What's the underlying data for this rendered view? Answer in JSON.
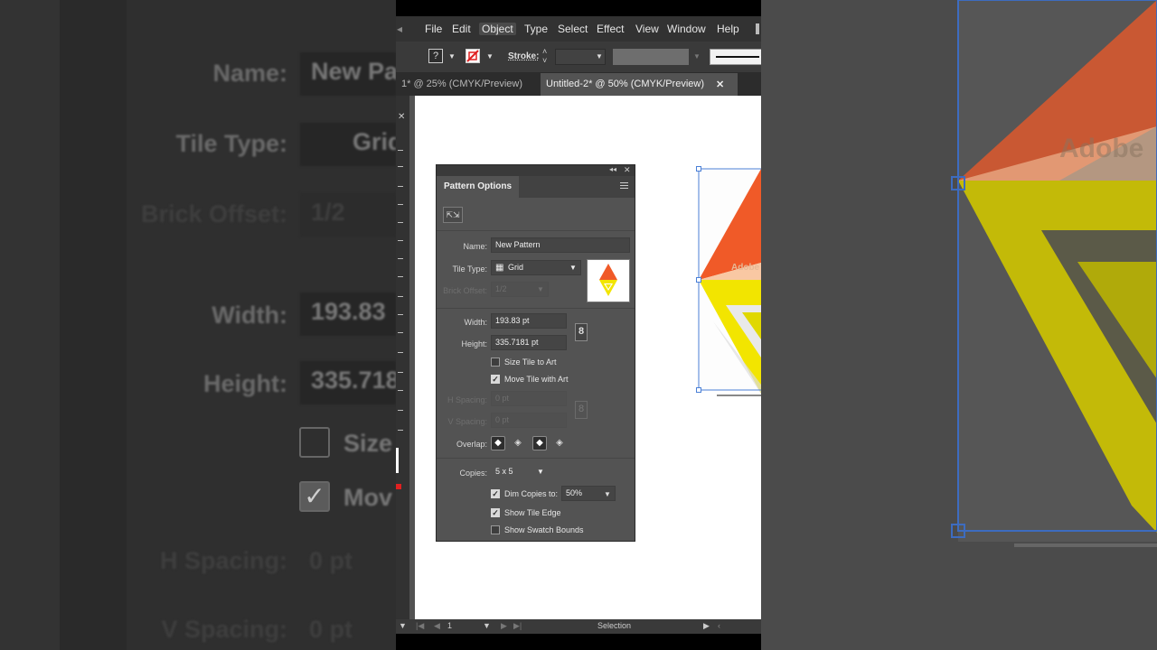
{
  "menu": [
    "File",
    "Edit",
    "Object",
    "Type",
    "Select",
    "Effect",
    "View",
    "Window",
    "Help"
  ],
  "menu_active": "Object",
  "control_bar": {
    "stroke_label": "Stroke:",
    "fill_swatch": "?"
  },
  "tabs": [
    {
      "label": "1* @ 25% (CMYK/Preview)"
    },
    {
      "label": "Untitled-2* @ 50% (CMYK/Preview)"
    }
  ],
  "panel": {
    "title": "Pattern Options",
    "name_label": "Name:",
    "name_value": "New Pattern",
    "tile_type_label": "Tile Type:",
    "tile_type_value": "Grid",
    "brick_offset_label": "Brick Offset:",
    "brick_offset_value": "1/2",
    "width_label": "Width:",
    "width_value": "193.83 pt",
    "height_label": "Height:",
    "height_value": "335.7181 pt",
    "size_tile_label": "Size Tile to Art",
    "size_tile_checked": false,
    "move_tile_label": "Move Tile with Art",
    "move_tile_checked": true,
    "h_spacing_label": "H Spacing:",
    "h_spacing_value": "0 pt",
    "v_spacing_label": "V Spacing:",
    "v_spacing_value": "0 pt",
    "overlap_label": "Overlap:",
    "copies_label": "Copies:",
    "copies_value": "5 x 5",
    "dim_copies_label": "Dim Copies to:",
    "dim_copies_value": "50%",
    "dim_copies_checked": true,
    "show_tile_edge_label": "Show Tile Edge",
    "show_tile_edge_checked": true,
    "show_swatch_bounds_label": "Show Swatch Bounds",
    "show_swatch_bounds_checked": false
  },
  "status": {
    "page": "1",
    "tool": "Selection"
  },
  "background": {
    "name_label": "Name:",
    "name_value": "New Pa",
    "tile_type_label": "Tile Type:",
    "tile_type_value": "Grid",
    "brick_offset_label": "Brick Offset:",
    "brick_offset_value": "1/2",
    "width_label": "Width:",
    "width_value": "193.83",
    "height_label": "Height:",
    "height_value": "335.718",
    "size_label": "Size",
    "move_label": "Mov",
    "h_spacing_label": "H Spacing:",
    "h_spacing_value": "0 pt",
    "v_spacing_label": "V Spacing:",
    "v_spacing_value": "0 pt",
    "art_text": "Adobe"
  },
  "colors": {
    "orange": "#f05a28",
    "peach": "#f9c8a3",
    "yellow": "#f2e500",
    "selection": "#4a7fd6"
  }
}
